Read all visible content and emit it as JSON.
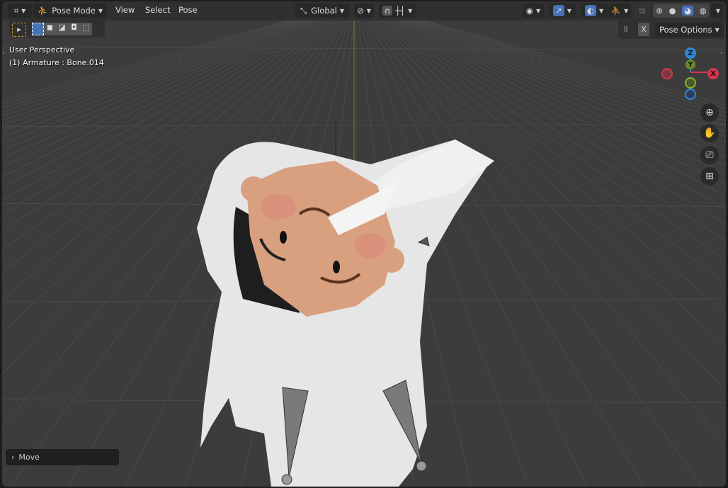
{
  "header": {
    "editor_type_icon": "viewport-icon",
    "mode": "Pose Mode",
    "menus": [
      "View",
      "Select",
      "Pose"
    ],
    "transform_orientation": "Global",
    "pivot_icon": "pivot-icon",
    "snap_icon": "magnet-icon",
    "snap_target_icon": "snap-increment-icon",
    "visibility_icon": "eye-icon",
    "gizmo_icon": "gizmo-icon",
    "overlay_icon": "overlay-icon",
    "bone_overlay_icon": "armature-icon",
    "xray_icon": "xray-icon",
    "shading_modes": [
      "wireframe",
      "solid",
      "material-preview",
      "rendered"
    ],
    "active_shading": "material-preview"
  },
  "toolbar": {
    "select_tool_icon": "cursor-select-icon",
    "select_modes": [
      "set",
      "extend",
      "subtract",
      "invert",
      "intersect"
    ]
  },
  "pose_bar": {
    "mirror_icon": "x-mirror-icon",
    "mirror_axis": "X",
    "options_label": "Pose Options"
  },
  "overlay": {
    "view_name": "User Perspective",
    "object_info": "(1) Armature : Bone.014"
  },
  "gizmo": {
    "z": "Z",
    "y": "Y",
    "x": "X"
  },
  "nav_buttons": [
    "zoom-icon",
    "hand-pan-icon",
    "camera-icon",
    "grid-ortho-icon"
  ],
  "last_operator": {
    "label": "Move"
  },
  "colors": {
    "accent": "#4772b3",
    "x_axis": "#d7354d",
    "y_axis": "#86b32a",
    "z_axis": "#2e86d8",
    "skin": "#d9a07f"
  }
}
